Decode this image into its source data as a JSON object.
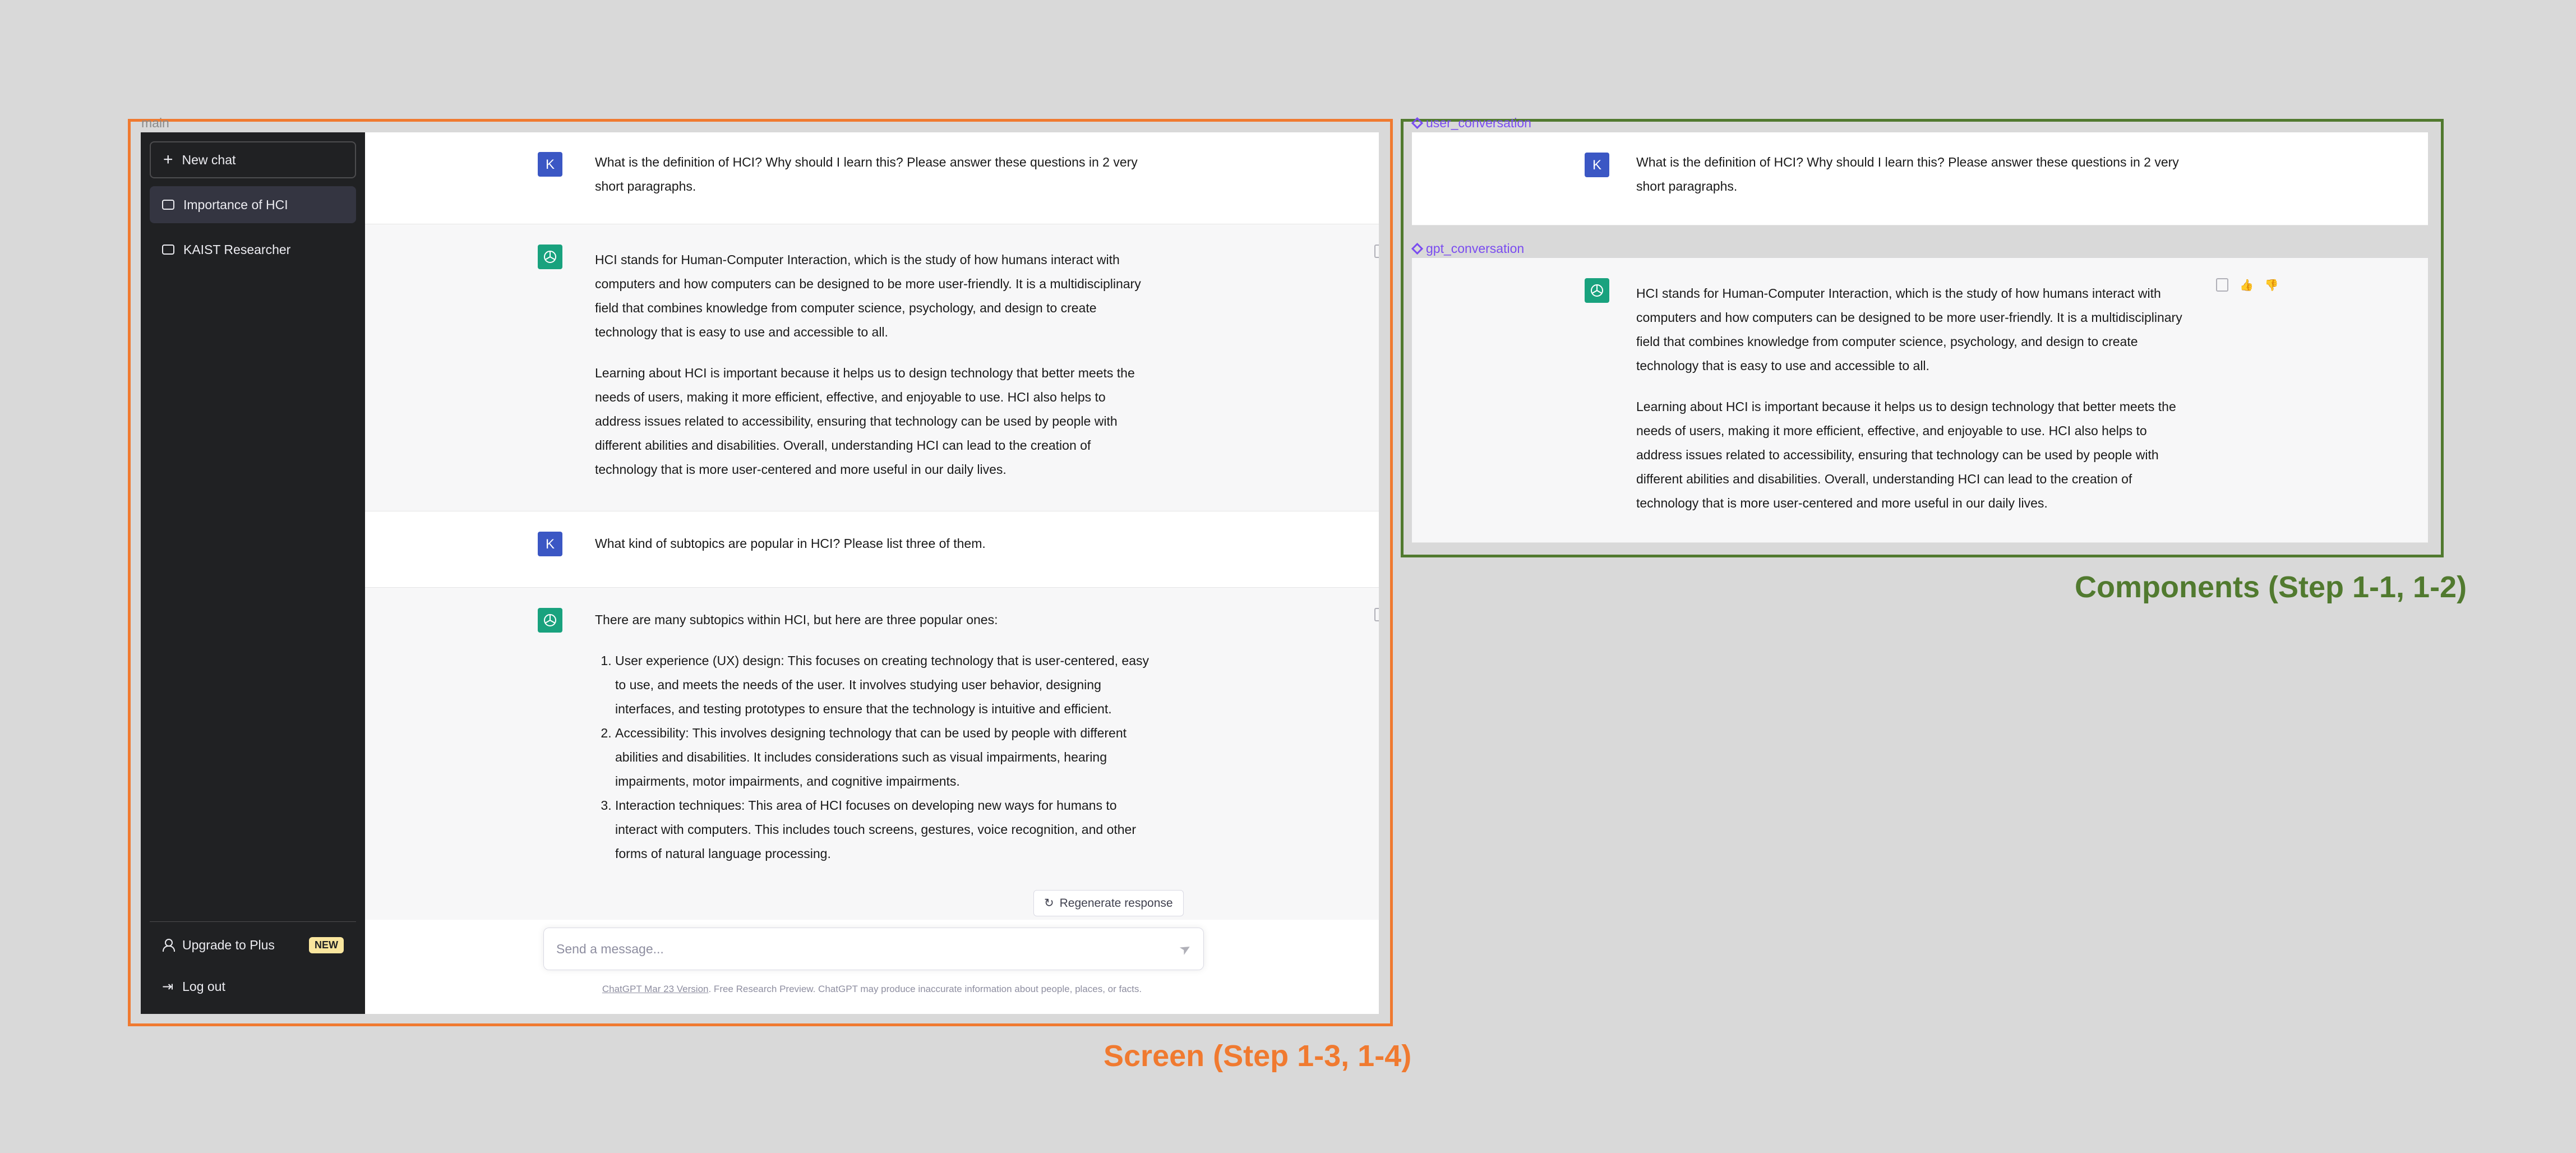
{
  "frames": {
    "main_label": "main",
    "user_component_label": "user_conversation",
    "gpt_component_label": "gpt_conversation",
    "screen_caption": "Screen (Step 1-3, 1-4)",
    "components_caption": "Components (Step 1-1, 1-2)"
  },
  "sidebar": {
    "new_chat": "New chat",
    "items": [
      {
        "label": "Importance of HCI",
        "active": true
      },
      {
        "label": "KAIST Researcher",
        "active": false
      }
    ],
    "upgrade": "Upgrade to Plus",
    "upgrade_badge": "NEW",
    "logout": "Log out"
  },
  "conversation": {
    "user_avatar": "K",
    "messages": [
      {
        "role": "user",
        "text": "What is the definition of HCI? Why should I learn this? Please answer these questions in 2 very short paragraphs."
      },
      {
        "role": "assistant",
        "paragraphs": [
          "HCI stands for Human-Computer Interaction, which is the study of how humans interact with computers and how computers can be designed to be more user-friendly. It is a multidisciplinary field that combines knowledge from computer science, psychology, and design to create technology that is easy to use and accessible to all.",
          "Learning about HCI is important because it helps us to design technology that better meets the needs of users, making it more efficient, effective, and enjoyable to use. HCI also helps to address issues related to accessibility, ensuring that technology can be used by people with different abilities and disabilities. Overall, understanding HCI can lead to the creation of technology that is more user-centered and more useful in our daily lives."
        ]
      },
      {
        "role": "user",
        "text": "What kind of subtopics are popular in HCI? Please list three of them."
      },
      {
        "role": "assistant",
        "intro": "There are many subtopics within HCI, but here are three popular ones:",
        "list": [
          "User experience (UX) design: This focuses on creating technology that is user-centered, easy to use, and meets the needs of the user. It involves studying user behavior, designing interfaces, and testing prototypes to ensure that the technology is intuitive and efficient.",
          "Accessibility: This involves designing technology that can be used by people with different abilities and disabilities. It includes considerations such as visual impairments, hearing impairments, motor impairments, and cognitive impairments.",
          "Interaction techniques: This area of HCI focuses on developing new ways for humans to interact with computers. This includes touch screens, gestures, voice recognition, and other forms of natural language processing."
        ]
      }
    ]
  },
  "composer": {
    "regenerate": "Regenerate response",
    "placeholder": "Send a message...",
    "footer_link": "ChatGPT Mar 23 Version",
    "footer_text": ". Free Research Preview. ChatGPT may produce inaccurate information about people, places, or facts."
  },
  "colors": {
    "screen_frame": "#f07a30",
    "components_frame": "#517a2f",
    "component_label": "#7a4cf0",
    "sidebar_bg": "#202123",
    "user_avatar_bg": "#3b57c4",
    "gpt_avatar_bg": "#19a27e"
  }
}
